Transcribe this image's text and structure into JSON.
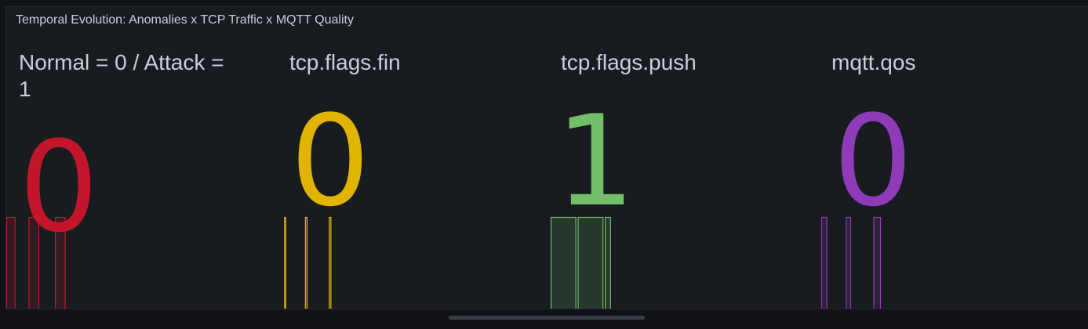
{
  "panel": {
    "title": "Temporal Evolution: Anomalies x TCP Traffic x MQTT Quality"
  },
  "stats": [
    {
      "name_line1": "Normal = 0 / Attack =",
      "name_line2": "1",
      "value": "0",
      "color": "#c4162a",
      "spikes": [
        {
          "start": 0.0,
          "end": 0.14,
          "level": 1
        },
        {
          "start": 0.34,
          "end": 0.5,
          "level": 1
        },
        {
          "start": 0.74,
          "end": 0.9,
          "level": 1
        }
      ]
    },
    {
      "name_line1": "tcp.flags.fin",
      "value": "0",
      "color": "#e0b400",
      "spikes": [
        {
          "start": 0.03,
          "end": 0.06,
          "level": 1
        },
        {
          "start": 0.37,
          "end": 0.41,
          "level": 1
        },
        {
          "start": 0.76,
          "end": 0.8,
          "level": 1
        }
      ]
    },
    {
      "name_line1": "tcp.flags.push",
      "value": "1",
      "color": "#73bf69",
      "spikes": [
        {
          "start": 0.0,
          "end": 0.34,
          "level": 1
        },
        {
          "start": 0.36,
          "end": 0.7,
          "level": 1
        },
        {
          "start": 0.72,
          "end": 0.8,
          "level": 1
        }
      ]
    },
    {
      "name_line1": "mqtt.qos",
      "value": "0",
      "color": "#8f3bb8",
      "spikes": [
        {
          "start": 0.0,
          "end": 0.08,
          "level": 1
        },
        {
          "start": 0.33,
          "end": 0.4,
          "level": 1
        },
        {
          "start": 0.7,
          "end": 0.8,
          "level": 1
        }
      ]
    }
  ]
}
